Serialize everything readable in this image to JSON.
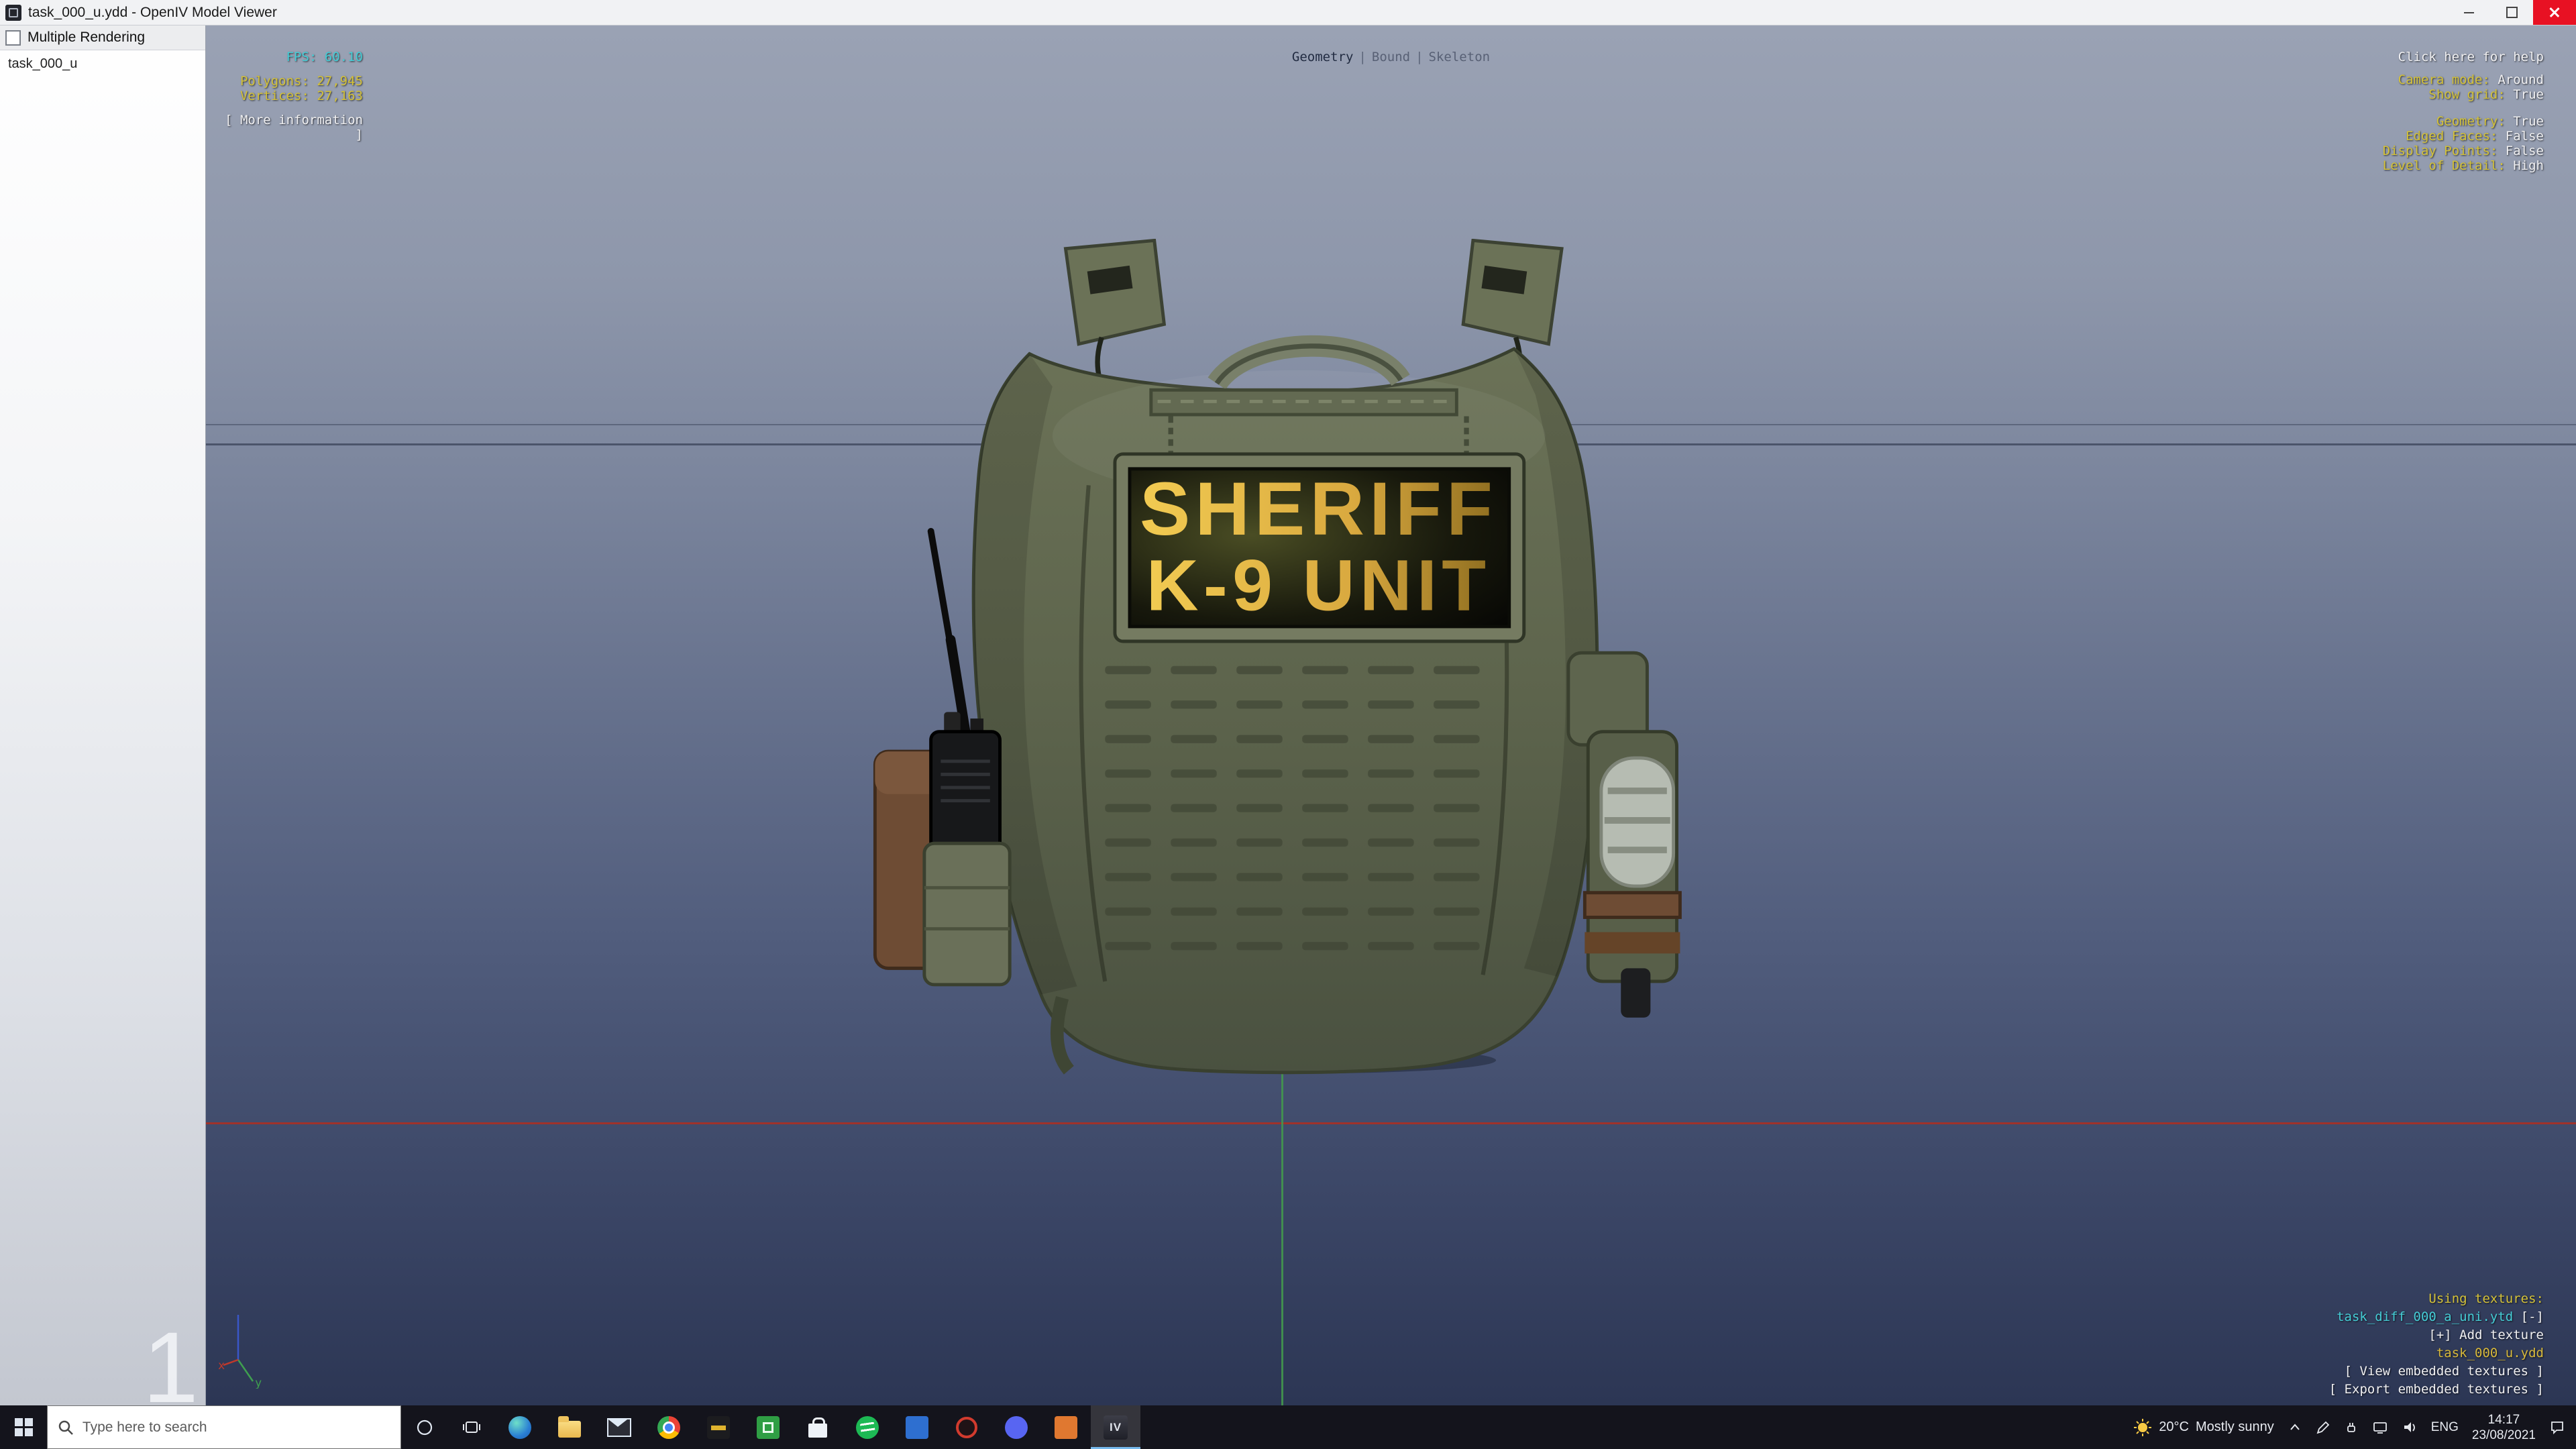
{
  "window": {
    "title": "task_000_u.ydd - OpenIV Model Viewer"
  },
  "sidebar": {
    "header": "Multiple Rendering",
    "items": [
      {
        "label": "task_000_u"
      }
    ],
    "page_indicator": "1"
  },
  "viewport": {
    "stats": {
      "fps": "FPS: 60.10",
      "polygons": "Polygons: 27,945",
      "vertices": "Vertices: 27,163",
      "more_info": "[ More information ]"
    },
    "tabs": {
      "separator": "|",
      "items": [
        {
          "label": "Geometry"
        },
        {
          "label": "Bound"
        },
        {
          "label": "Skeleton"
        }
      ]
    },
    "help_link": "Click here for help",
    "settings_camera": [
      {
        "label": "Camera mode:",
        "value": "Around"
      },
      {
        "label": "Show grid:",
        "value": "True"
      }
    ],
    "settings_render": [
      {
        "label": "Geometry:",
        "value": "True"
      },
      {
        "label": "Edged Faces:",
        "value": "False"
      },
      {
        "label": "Display Points:",
        "value": "False"
      },
      {
        "label": "Level of Detail:",
        "value": "High"
      }
    ],
    "textures": {
      "header": "Using textures:",
      "entry": "task_diff_000_a_uni.ytd",
      "entry_action": "[-]",
      "add": "[+] Add texture",
      "model_file": "task_000_u.ydd",
      "view": "[ View embedded textures ]",
      "export": "[ Export embedded textures ]"
    },
    "model": {
      "patch_line1": "SHERIFF",
      "patch_line2": "K-9 UNIT"
    },
    "axis": {
      "x": "x",
      "y": "y"
    }
  },
  "taskbar": {
    "search_placeholder": "Type here to search",
    "app_icons": [
      "edge",
      "file-explorer",
      "mail",
      "chrome",
      "rage-plugin",
      "green-app",
      "microsoft-store",
      "spotify",
      "blue-app",
      "red-circle-app",
      "discord",
      "orange-app",
      "openiv"
    ],
    "openiv_label": "IV",
    "weather": {
      "temp": "20°C",
      "condition": "Mostly sunny"
    },
    "tray": {
      "language": "ENG",
      "time": "14:17",
      "date": "23/08/2021"
    }
  },
  "colors": {
    "accent_yellow": "#d4c23a",
    "accent_cyan": "#45cdd6",
    "patch_gold": "#d9a93f",
    "vest_green": "#5c634b",
    "taskbar_bg": "#14141c",
    "close_red": "#e81123"
  }
}
